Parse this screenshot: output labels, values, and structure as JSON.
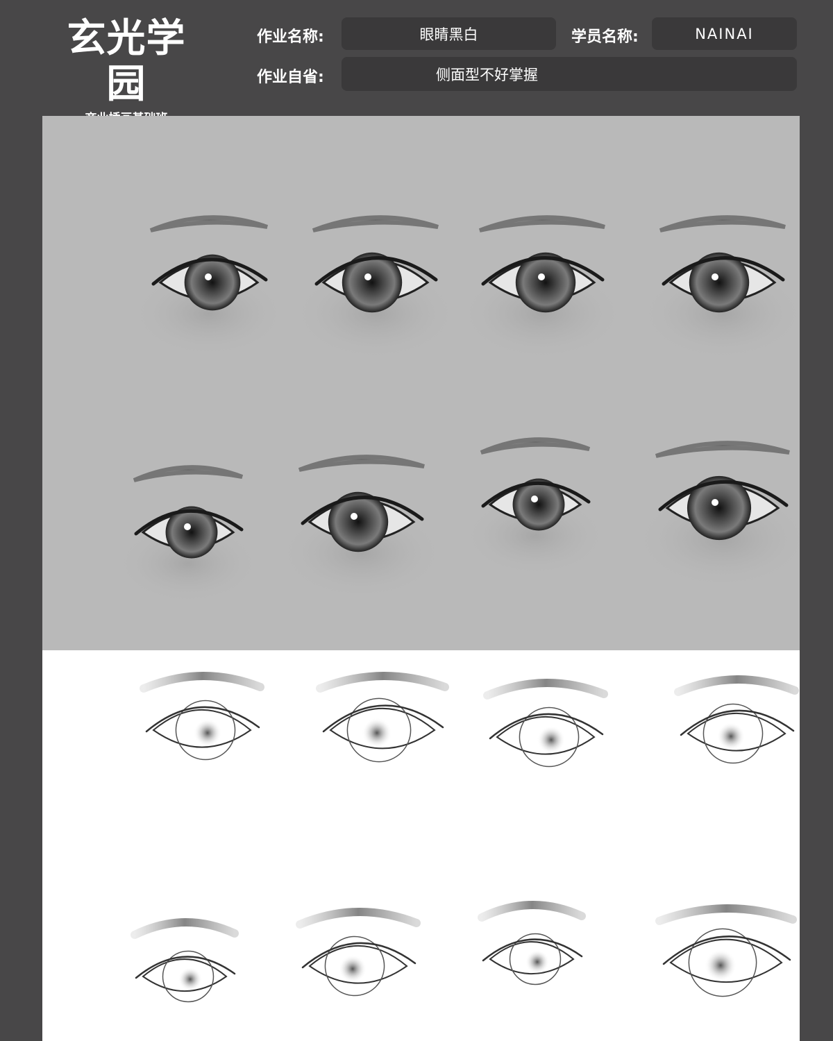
{
  "logo": {
    "title": "玄光学园",
    "subtitle": "商业插画基础班"
  },
  "form": {
    "work_name_label": "作业名称:",
    "work_name_value": "眼睛黑白",
    "student_name_label": "学员名称:",
    "student_name_value": "NAINAI",
    "reflection_label": "作业自省:",
    "reflection_value": "侧面型不好掌握"
  },
  "colors": {
    "page_bg": "#484748",
    "field_bg": "#3a393a",
    "rendered_panel_bg": "#b9b9b9",
    "lineart_panel_bg": "#ffffff"
  },
  "artwork": {
    "rendered_panel": "grayscale painted eye studies, 4 pairs",
    "lineart_panel": "line-art eye sketches, 4 pairs"
  }
}
